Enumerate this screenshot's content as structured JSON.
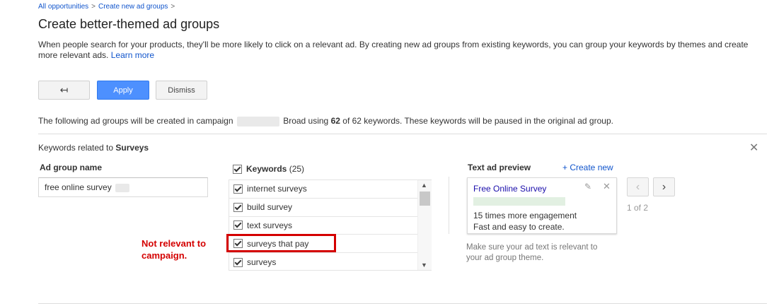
{
  "breadcrumb": {
    "item1": "All opportunities",
    "item2": "Create new ad groups",
    "sep": ">"
  },
  "page": {
    "title": "Create better-themed ad groups",
    "intro": "When people search for your products, they'll be more likely to click on a relevant ad. By creating new ad groups from existing keywords, you can group your keywords by themes and create more relevant ads.",
    "learn_more": "Learn more"
  },
  "toolbar": {
    "back_icon": "↤",
    "apply": "Apply",
    "dismiss": "Dismiss"
  },
  "summary": {
    "prefix": "The following ad groups will be created in campaign",
    "campaign_suffix": "Broad using",
    "used": "62",
    "of": "of 62 keywords. These keywords will be paused in the original ad group."
  },
  "related": {
    "prefix": "Keywords related to",
    "topic": "Surveys",
    "close": "✕"
  },
  "adgroup": {
    "header": "Ad group name",
    "value": "free online survey"
  },
  "keywords": {
    "header": "Keywords",
    "count": "(25)",
    "items": [
      "internet surveys",
      "build survey",
      "text surveys",
      "surveys that pay",
      "surveys"
    ]
  },
  "annotation": {
    "line1": "Not relevant to",
    "line2": "campaign."
  },
  "preview": {
    "header": "Text ad preview",
    "create_new": "+ Create new",
    "ad_title": "Free Online Survey",
    "line1": "15 times more engagement",
    "line2": "Fast and easy to create.",
    "page": "1 of 2",
    "hint": "Make sure your ad text is relevant to your ad group theme."
  },
  "colors": {
    "link": "#1155cc",
    "apply": "#4d90fe",
    "annotation": "#d40000"
  }
}
